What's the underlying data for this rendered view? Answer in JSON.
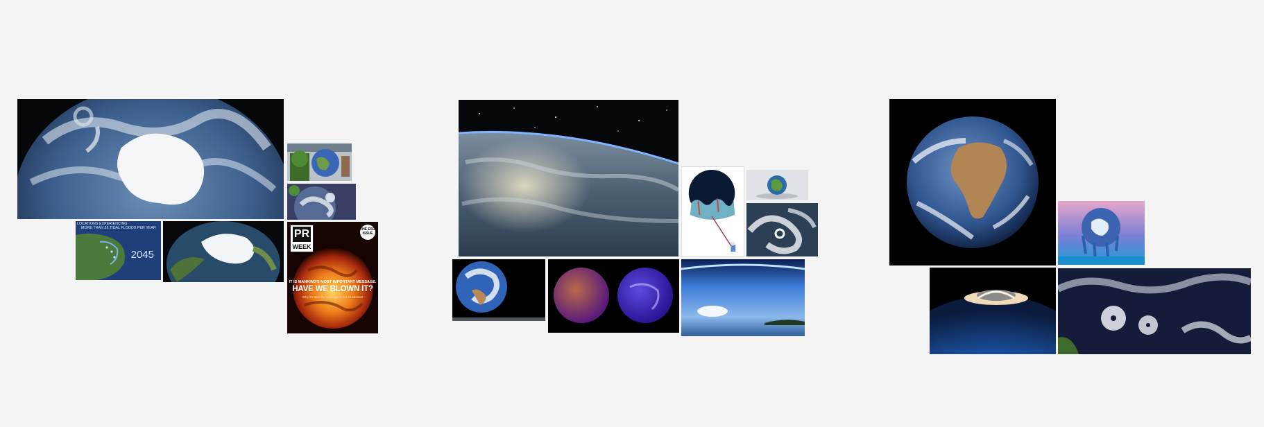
{
  "page": {
    "background": "#f4f4f4"
  },
  "groups": [
    {
      "name": "cluster-left",
      "tiles": [
        {
          "id": "antarctica-earth",
          "icon": "antarctica-earth-image"
        },
        {
          "id": "tree-globe",
          "icon": "tree-globe-image"
        },
        {
          "id": "storm-globe",
          "icon": "storm-globe-image"
        },
        {
          "id": "tidal-floods-map",
          "icon": "flood-map-image",
          "caption_line1": "LOCATIONS EXPERIENCING",
          "caption_line2": "MORE THAN 26 TIDAL FLOODS PER YEAR",
          "year": "2045"
        },
        {
          "id": "arctic-globe",
          "icon": "arctic-ice-globe-image"
        },
        {
          "id": "pr-week-cover",
          "icon": "burning-earth-magazine-cover",
          "logo_text": "PR",
          "logo_sub": "WEEK",
          "badge": "THE ESG ISSUE",
          "kicker": "IT IS MANKIND'S MOST IMPORTANT MESSAGE.",
          "headline": "HAVE WE BLOWN IT?",
          "subline": "Why it's time the message is not so abstract"
        }
      ]
    },
    {
      "name": "cluster-middle",
      "tiles": [
        {
          "id": "orbit-horizon",
          "icon": "earth-from-orbit-image"
        },
        {
          "id": "balloon-earth-cartoon",
          "icon": "astronaut-balloon-cartoon"
        },
        {
          "id": "earth-on-table",
          "icon": "small-earth-model-image"
        },
        {
          "id": "swirling-clouds",
          "icon": "cloud-swirl-image"
        },
        {
          "id": "blue-marble-small",
          "icon": "blue-marble-image"
        },
        {
          "id": "twin-globes",
          "icon": "twin-purple-globes-image"
        },
        {
          "id": "atmosphere-limb",
          "icon": "atmosphere-ocean-image"
        }
      ]
    },
    {
      "name": "cluster-right",
      "tiles": [
        {
          "id": "africa-full-disk",
          "icon": "africa-earth-disk-image"
        },
        {
          "id": "melting-earth",
          "icon": "melting-earth-image"
        },
        {
          "id": "asteroid-impact",
          "icon": "asteroid-impact-image"
        },
        {
          "id": "hurricanes-satellite",
          "icon": "hurricane-satellite-image"
        }
      ]
    }
  ]
}
